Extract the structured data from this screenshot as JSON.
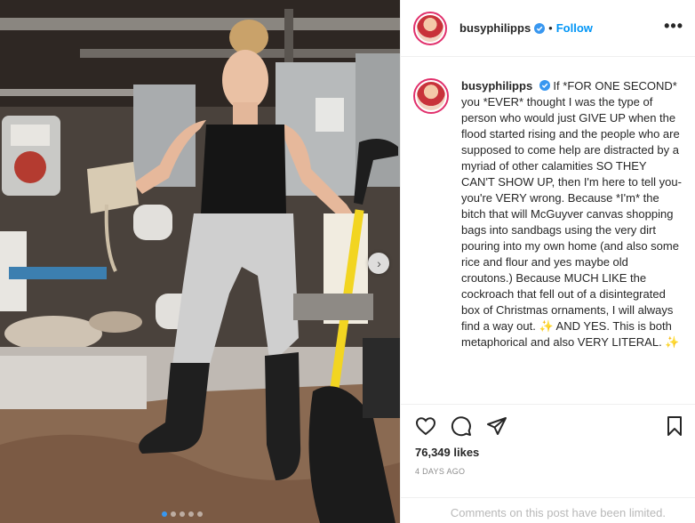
{
  "header": {
    "username": "busyphilipps",
    "separator": "•",
    "follow_label": "Follow",
    "more_label": "•••"
  },
  "caption": {
    "username": "busyphilipps",
    "text": "If *FOR ONE SECOND* you *EVER* thought I was the type of person who would just GIVE UP when the flood started rising and the people who are supposed to come help are distracted by a myriad of other calamities SO THEY CAN'T SHOW UP, then I'm here to tell you- you're VERY wrong. Because *I'm* the bitch that will McGuyver canvas shopping bags into sandbags using the very dirt pouring into my own home (and also some rice and flour and yes maybe old croutons.) Because MUCH LIKE the cockroach that fell out of a disintegrated box of Christmas ornaments, I will always find a way out. ✨ AND YES. This is both metaphorical and also VERY LITERAL. ✨"
  },
  "stats": {
    "likes": "76,349 likes",
    "date": "4 DAYS AGO"
  },
  "comments": {
    "limited_text": "Comments on this post have been limited."
  },
  "carousel": {
    "next_label": "›",
    "dot_count": 5,
    "active_dot": 0
  },
  "colors": {
    "follow_blue": "#0095f6",
    "verified_blue": "#3897f0",
    "story_ring": "#e1306c"
  },
  "icons": [
    "verified-badge-icon",
    "more-options-icon",
    "heart-icon",
    "comment-icon",
    "share-icon",
    "bookmark-icon",
    "chevron-right-icon"
  ]
}
